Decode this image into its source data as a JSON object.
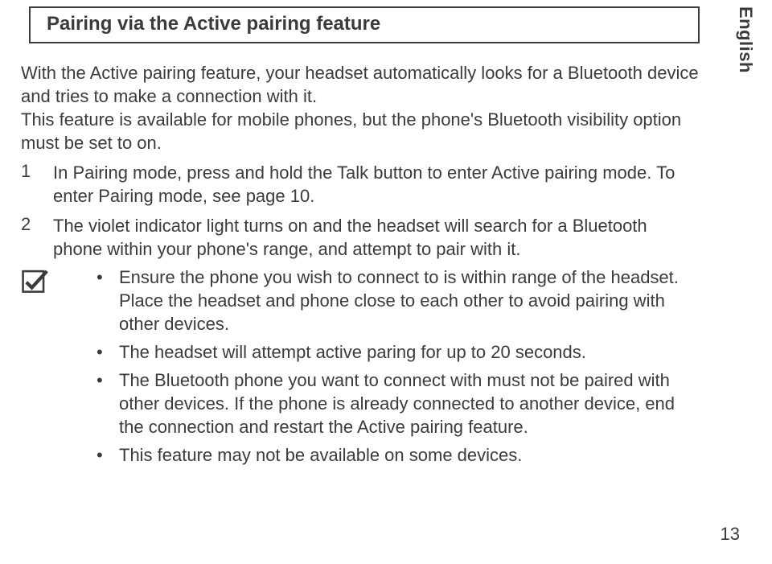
{
  "language_tab": "English",
  "title": "Pairing via the Active pairing feature",
  "intro": "With the Active pairing feature, your headset automatically looks for a Bluetooth device and tries to make a connection with it.",
  "intro2": "This feature is available for mobile phones, but the phone's Bluetooth visibility option must be set to on.",
  "steps": [
    {
      "num": "1",
      "text": "In Pairing mode, press and hold the Talk button to enter Active pairing mode. To enter Pairing mode, see page 10."
    },
    {
      "num": "2",
      "text": "The violet indicator light turns on and the headset will search for a Bluetooth phone within your phone's range, and attempt to pair with it."
    }
  ],
  "notes": [
    "Ensure the phone you wish to connect to is within range of the headset. Place the headset and phone close to each other to avoid pairing with other devices.",
    "The headset will attempt active paring for up to 20 seconds.",
    "The Bluetooth phone you want to connect with must not be paired with other devices. If the phone is already connected to another device, end the connection and restart the Active pairing feature.",
    "This feature may not be available on some devices."
  ],
  "pagenum": "13"
}
